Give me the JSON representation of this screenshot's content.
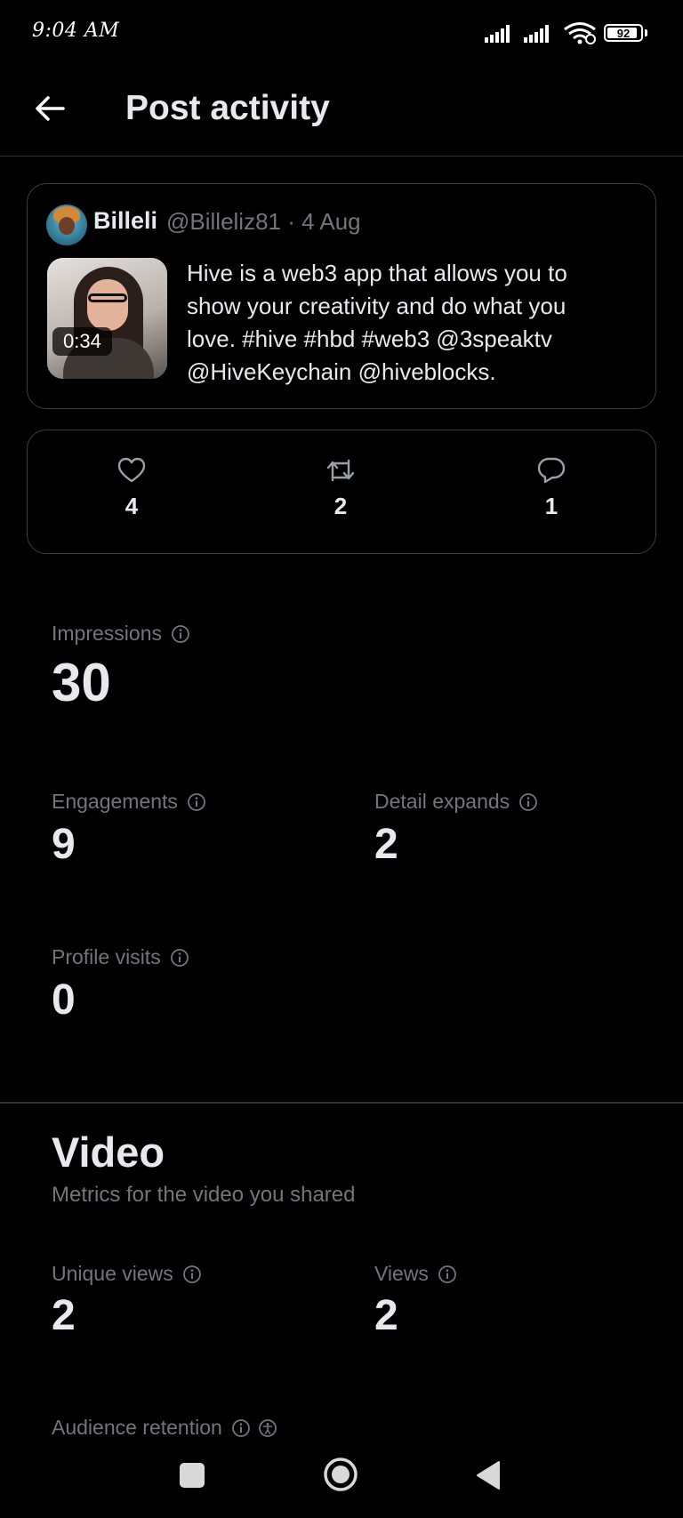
{
  "status_bar": {
    "time": "9:04 AM",
    "battery": "92",
    "battery_fraction": 0.92
  },
  "header": {
    "title": "Post activity",
    "back_icon": "arrow-left-icon"
  },
  "post": {
    "display_name": "Billeli",
    "handle_date": "@Billeliz81 · 4 Aug",
    "video_duration": "0:34",
    "text": "Hive is a web3 app that allows you to\nshow your creativity and do what you\nlove. #hive #hbd #web3 @3speaktv\n@HiveKeychain  @hiveblocks."
  },
  "engagement": {
    "likes": "4",
    "reposts": "2",
    "replies": "1"
  },
  "metrics": {
    "impressions": {
      "label": "Impressions",
      "value": "30"
    },
    "engagements": {
      "label": "Engagements",
      "value": "9"
    },
    "detail_expands": {
      "label": "Detail expands",
      "value": "2"
    },
    "profile_visits": {
      "label": "Profile visits",
      "value": "0"
    }
  },
  "video": {
    "title": "Video",
    "subtitle": "Metrics for the video you shared",
    "unique_views": {
      "label": "Unique views",
      "value": "2"
    },
    "views": {
      "label": "Views",
      "value": "2"
    },
    "audience_retention": {
      "label": "Audience retention"
    }
  },
  "colors": {
    "background": "#000000",
    "primary_text": "#e7e9ea",
    "secondary_text": "#71767b",
    "border": "#3a3d41"
  }
}
